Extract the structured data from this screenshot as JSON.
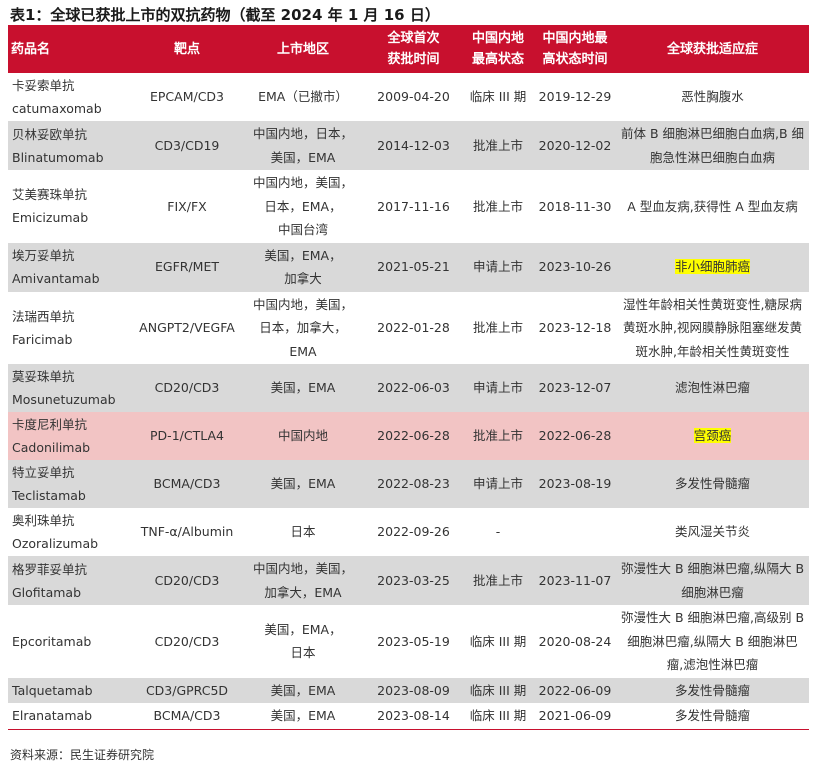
{
  "title": "表1：全球已获批上市的双抗药物（截至 2024 年 1 月 16 日）",
  "headers": [
    "药品名",
    "靶点",
    "上市地区",
    "全球首次\n获批时间",
    "中国内地\n最高状态",
    "中国内地最\n高状态时间",
    "全球获批适应症"
  ],
  "rows": [
    {
      "style": "white",
      "name": "卡妥索单抗\ncatumaxomab",
      "target": "EPCAM/CD3",
      "region": "EMA（已撤市）",
      "first": "2009-04-20",
      "cn_status": "临床 III 期",
      "cn_time": "2019-12-29",
      "ind": "恶性胸腹水"
    },
    {
      "style": "gray",
      "name": "贝林妥欧单抗\nBlinatumomab",
      "target": "CD3/CD19",
      "region": "中国内地，日本，\n美国，EMA",
      "first": "2014-12-03",
      "cn_status": "批准上市",
      "cn_time": "2020-12-02",
      "ind": "前体 B 细胞淋巴细胞白血病,B 细\n胞急性淋巴细胞白血病"
    },
    {
      "style": "white",
      "name": "艾美赛珠单抗\nEmicizumab",
      "target": "FIX/FX",
      "region": "中国内地，美国，\n日本，EMA，\n中国台湾",
      "first": "2017-11-16",
      "cn_status": "批准上市",
      "cn_time": "2018-11-30",
      "ind": "A 型血友病,获得性 A 型血友病"
    },
    {
      "style": "gray",
      "name": "埃万妥单抗\nAmivantamab",
      "target": "EGFR/MET",
      "region": "美国，EMA，\n加拿大",
      "first": "2021-05-21",
      "cn_status": "申请上市",
      "cn_time": "2023-10-26",
      "ind": "非小细胞肺癌",
      "hl": true
    },
    {
      "style": "white",
      "name": "法瑞西单抗\nFaricimab",
      "target": "ANGPT2/VEGFA",
      "region": "中国内地，美国，\n日本，加拿大，\nEMA",
      "first": "2022-01-28",
      "cn_status": "批准上市",
      "cn_time": "2023-12-18",
      "ind": "湿性年龄相关性黄斑变性,糖尿病\n黄斑水肿,视网膜静脉阻塞继发黄\n斑水肿,年龄相关性黄斑变性"
    },
    {
      "style": "gray",
      "name": "莫妥珠单抗\nMosunetuzumab",
      "target": "CD20/CD3",
      "region": "美国，EMA",
      "first": "2022-06-03",
      "cn_status": "申请上市",
      "cn_time": "2023-12-07",
      "ind": "滤泡性淋巴瘤"
    },
    {
      "style": "pink",
      "name": "卡度尼利单抗\nCadonilimab",
      "target": "PD-1/CTLA4",
      "region": "中国内地",
      "first": "2022-06-28",
      "cn_status": "批准上市",
      "cn_time": "2022-06-28",
      "ind": "宫颈癌",
      "hl": true
    },
    {
      "style": "gray",
      "name": "特立妥单抗\nTeclistamab",
      "target": "BCMA/CD3",
      "region": "美国，EMA",
      "first": "2022-08-23",
      "cn_status": "申请上市",
      "cn_time": "2023-08-19",
      "ind": "多发性骨髓瘤"
    },
    {
      "style": "white",
      "name": "奥利珠单抗\nOzoralizumab",
      "target": "TNF-α/Albumin",
      "region": "日本",
      "first": "2022-09-26",
      "cn_status": "-",
      "cn_time": "",
      "ind": "类风湿关节炎"
    },
    {
      "style": "gray",
      "name": "格罗菲妥单抗\nGlofitamab",
      "target": "CD20/CD3",
      "region": "中国内地，美国，\n加拿大，EMA",
      "first": "2023-03-25",
      "cn_status": "批准上市",
      "cn_time": "2023-11-07",
      "ind": "弥漫性大 B 细胞淋巴瘤,纵隔大 B\n细胞淋巴瘤"
    },
    {
      "style": "white",
      "name": "Epcoritamab",
      "target": "CD20/CD3",
      "region": "美国，EMA，\n日本",
      "first": "2023-05-19",
      "cn_status": "临床 III 期",
      "cn_time": "2020-08-24",
      "ind": "弥漫性大 B 细胞淋巴瘤,高级别 B\n细胞淋巴瘤,纵隔大 B 细胞淋巴\n瘤,滤泡性淋巴瘤"
    },
    {
      "style": "gray",
      "name": "Talquetamab",
      "target": "CD3/GPRC5D",
      "region": "美国，EMA",
      "first": "2023-08-09",
      "cn_status": "临床 III 期",
      "cn_time": "2022-06-09",
      "ind": "多发性骨髓瘤"
    },
    {
      "style": "white",
      "name": "Elranatamab",
      "target": "BCMA/CD3",
      "region": "美国，EMA",
      "first": "2023-08-14",
      "cn_status": "临床 III 期",
      "cn_time": "2021-06-09",
      "ind": "多发性骨髓瘤"
    }
  ],
  "source": "资料来源：民生证券研究院",
  "colors": {
    "header_bg": "#c8102e",
    "gray_row": "#d9d9d9",
    "highlight_row": "#f2c4c4",
    "text_highlight": "#ffff00"
  }
}
